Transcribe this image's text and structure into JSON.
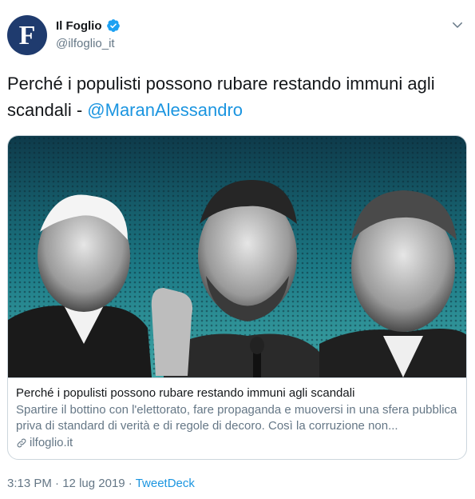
{
  "author": {
    "display_name": "Il Foglio",
    "handle": "@ilfoglio_it",
    "avatar_letter": "F",
    "verified": true,
    "avatar_color": "#1f3b6e"
  },
  "tweet": {
    "text": "Perché i populisti possono rubare restando immuni agli scandali - ",
    "mention": "@MaranAlessandro"
  },
  "card": {
    "title": "Perché i populisti possono rubare restando immuni agli scandali",
    "description": "Spartire il bottino con l'elettorato, fare propaganda e muoversi in una sfera pubblica priva di standard di verità e di regole di decoro. Così la corruzione non...",
    "domain": "ilfoglio.it"
  },
  "meta": {
    "time": "3:13 PM",
    "separator": "·",
    "date": "12 lug 2019",
    "source": "TweetDeck"
  },
  "colors": {
    "link": "#1b95e0",
    "secondary_text": "#657786",
    "border": "#ccd6dd",
    "card_background": "#1d7f86"
  },
  "icons": [
    "verified-badge-icon",
    "chevron-down-icon",
    "link-icon"
  ]
}
